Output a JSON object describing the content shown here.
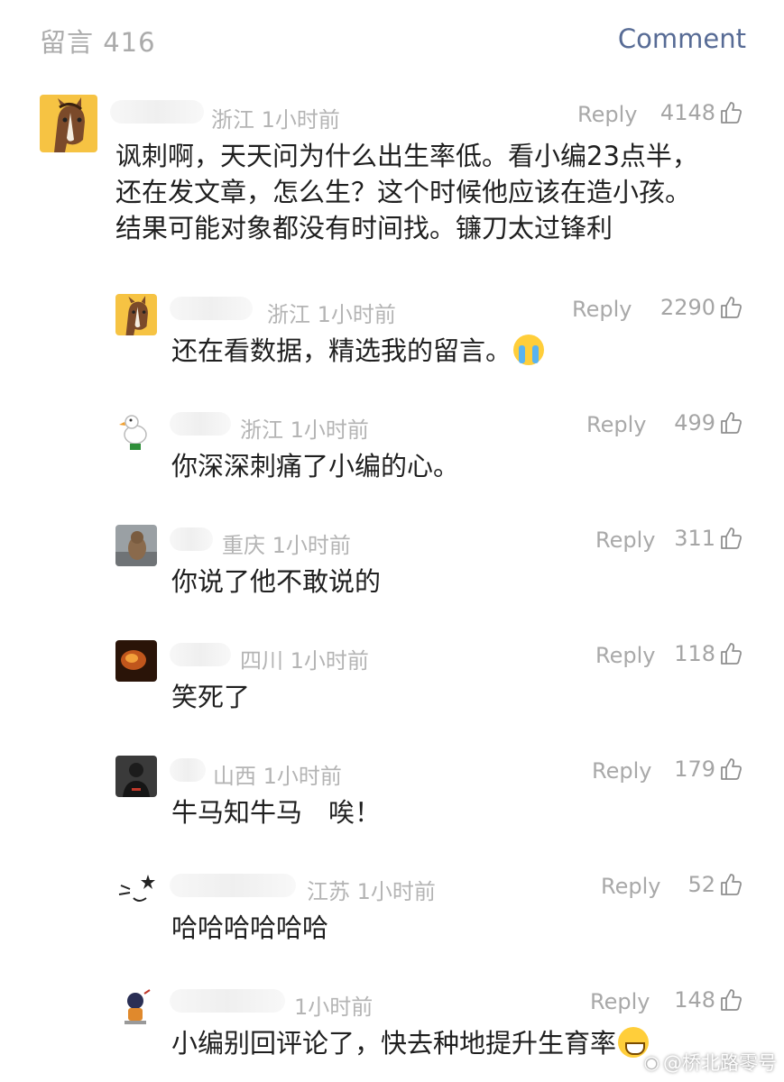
{
  "header": {
    "title": "留言 416",
    "action": "Comment"
  },
  "comments": [
    {
      "location": "浙江",
      "time": "1小时前",
      "reply": "Reply",
      "likes": "4148",
      "text": [
        "讽刺啊，天天问为什么出生率低。看小编23点半，",
        "还在发文章，怎么生？这个时候他应该在造小孩。",
        "结果可能对象都没有时间找。镰刀太过锋利"
      ]
    },
    {
      "location": "浙江",
      "time": "1小时前",
      "reply": "Reply",
      "likes": "2290",
      "text": "还在看数据，精选我的留言。"
    },
    {
      "location": "浙江",
      "time": "1小时前",
      "reply": "Reply",
      "likes": "499",
      "text": "你深深刺痛了小编的心。"
    },
    {
      "location": "重庆",
      "time": "1小时前",
      "reply": "Reply",
      "likes": "311",
      "text": "你说了他不敢说的"
    },
    {
      "location": "四川",
      "time": "1小时前",
      "reply": "Reply",
      "likes": "118",
      "text": "笑死了"
    },
    {
      "location": "山西",
      "time": "1小时前",
      "reply": "Reply",
      "likes": "179",
      "text": "牛马知牛马　唉！"
    },
    {
      "location": "江苏",
      "time": "1小时前",
      "reply": "Reply",
      "likes": "52",
      "text": "哈哈哈哈哈哈"
    },
    {
      "location": "",
      "time": "1小时前",
      "reply": "Reply",
      "likes": "148",
      "text": "小编别回评论了，快去种地提升生育率"
    }
  ],
  "watermark": "@桥北路零号",
  "icons": {
    "like": "thumbs-up-icon",
    "weibo": "weibo-icon"
  },
  "colors": {
    "link": "#576b95",
    "meta": "#b4b4b4",
    "text": "#1f1f1f"
  }
}
